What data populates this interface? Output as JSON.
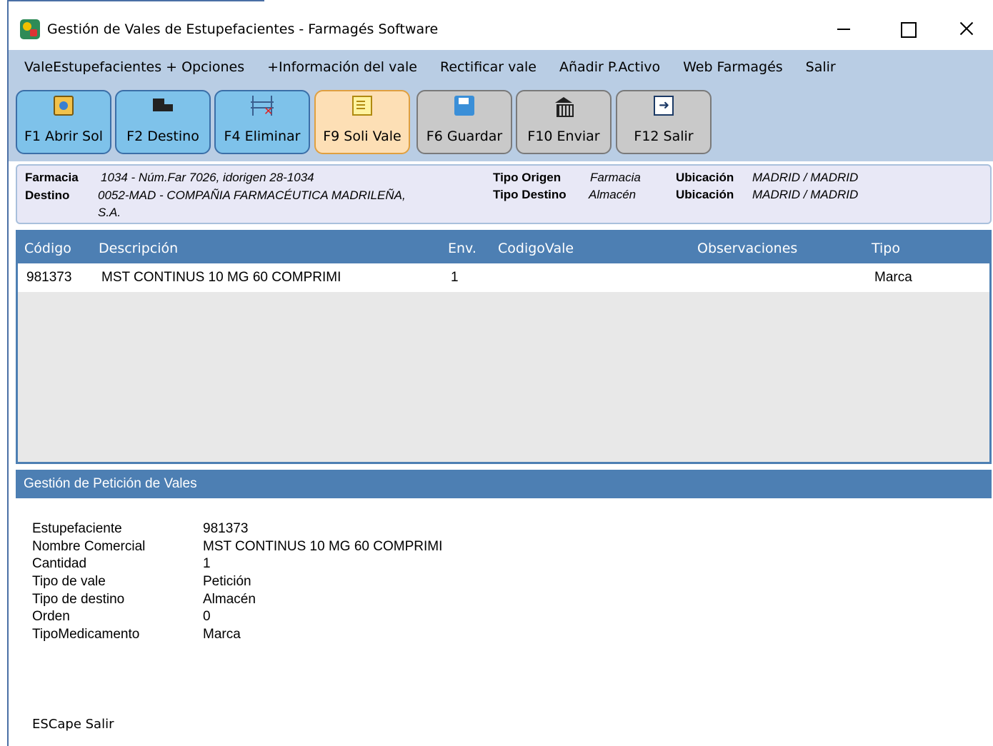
{
  "window": {
    "title": "Gestión de Vales de Estupefacientes - Farmagés Software"
  },
  "menu": {
    "items": [
      "ValeEstupefacientes + Opciones",
      "+Información del vale",
      "Rectificar vale",
      "Añadir P.Activo",
      "Web Farmagés",
      "Salir"
    ]
  },
  "toolbar": {
    "buttons": [
      {
        "label": "F1 Abrir Sol",
        "icon": "folder-globe-icon",
        "color": "#7ec2ea"
      },
      {
        "label": "F2 Destino",
        "icon": "truck-icon",
        "color": "#7ec2ea"
      },
      {
        "label": "F4 Eliminar",
        "icon": "grid-delete-icon",
        "color": "#7ec2ea"
      },
      {
        "label": "F9 Soli Vale",
        "icon": "list-arrow-icon",
        "color": "#fddfb5"
      },
      {
        "label": "F6 Guardar",
        "icon": "save-icon",
        "color": "#c9c9c9"
      },
      {
        "label": "F10 Enviar",
        "icon": "bank-icon",
        "color": "#c9c9c9"
      },
      {
        "label": "F12 Salir",
        "icon": "exit-icon",
        "color": "#c9c9c9"
      }
    ]
  },
  "info": {
    "farmacia_label": "Farmacia",
    "farmacia_value": "1034 - Núm.Far 7026, idorigen 28-1034",
    "destino_label": "Destino",
    "destino_value_line1": "0052-MAD - COMPAÑIA FARMACÉUTICA MADRILEÑA,",
    "destino_value_line2": "S.A.",
    "tipo_origen_label": "Tipo Origen",
    "tipo_origen_value": "Farmacia",
    "tipo_destino_label": "Tipo Destino",
    "tipo_destino_value": "Almacén",
    "ubicacion_label": "Ubicación",
    "ubicacion_origen_value": "MADRID / MADRID",
    "ubicacion_destino_value": "MADRID / MADRID"
  },
  "grid": {
    "columns": [
      "Código",
      "Descripción",
      "Env.",
      "CodigoVale",
      "Observaciones",
      "Tipo"
    ],
    "rows": [
      {
        "codigo": "981373",
        "descripcion": "MST CONTINUS 10 MG 60 COMPRIMI",
        "env": "1",
        "codigo_vale": "",
        "observaciones": "",
        "tipo": "Marca"
      }
    ]
  },
  "section": {
    "title": "Gestión de Petición de Vales"
  },
  "details": [
    {
      "label": "Estupefaciente",
      "value": "981373"
    },
    {
      "label": "Nombre Comercial",
      "value": "MST CONTINUS 10 MG 60 COMPRIMI"
    },
    {
      "label": "Cantidad",
      "value": "1"
    },
    {
      "label": "Tipo de vale",
      "value": "Petición"
    },
    {
      "label": "Tipo de destino",
      "value": "Almacén"
    },
    {
      "label": "Orden",
      "value": "0"
    },
    {
      "label": "TipoMedicamento",
      "value": "Marca"
    }
  ],
  "footer": {
    "hint": "ESCape Salir"
  }
}
